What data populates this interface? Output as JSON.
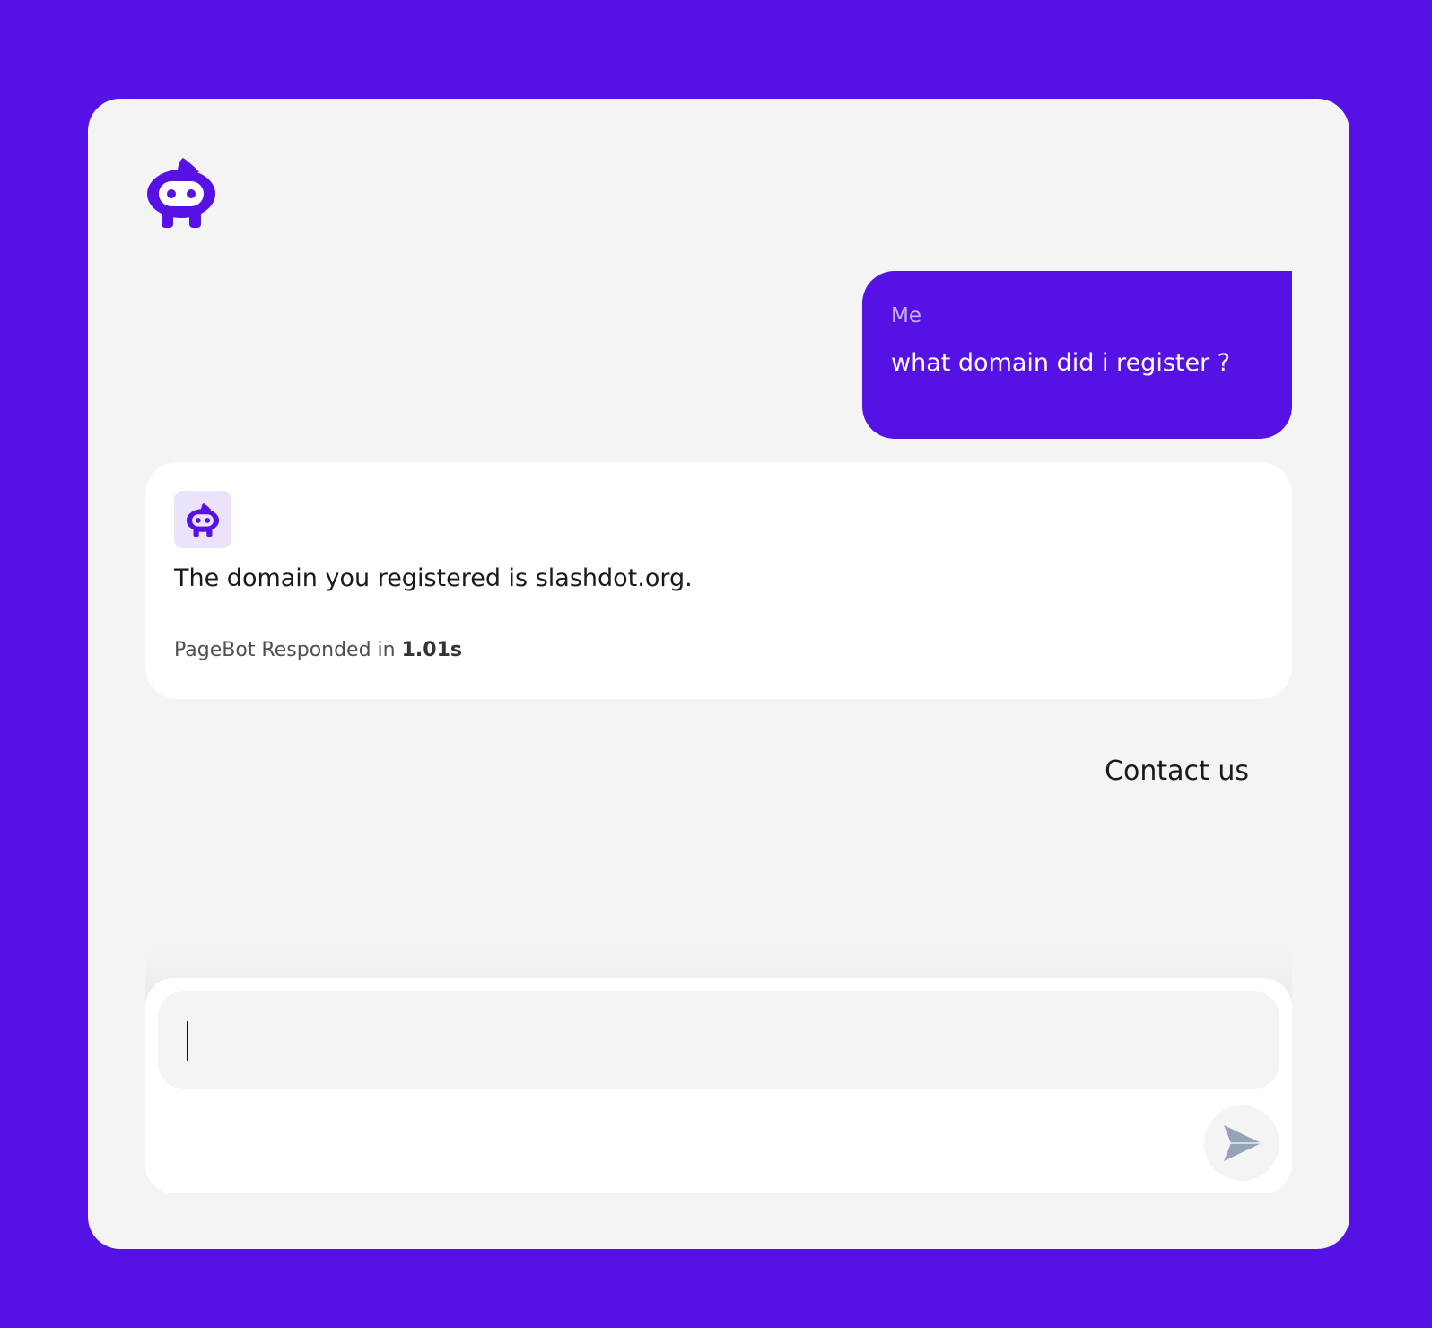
{
  "brand": {
    "logo_icon": "robot-icon",
    "accent_color": "#5611e5"
  },
  "conversation": {
    "user_message": {
      "sender": "Me",
      "text": "what domain did i register ?"
    },
    "bot_message": {
      "avatar_icon": "robot-icon",
      "text": "The domain you registered is slashdot.org.",
      "meta_prefix": "PageBot Responded in",
      "response_time": "1.01s"
    }
  },
  "contact": {
    "label": "Contact us"
  },
  "composer": {
    "input_value": "",
    "placeholder": "",
    "send_icon": "send-icon"
  }
}
